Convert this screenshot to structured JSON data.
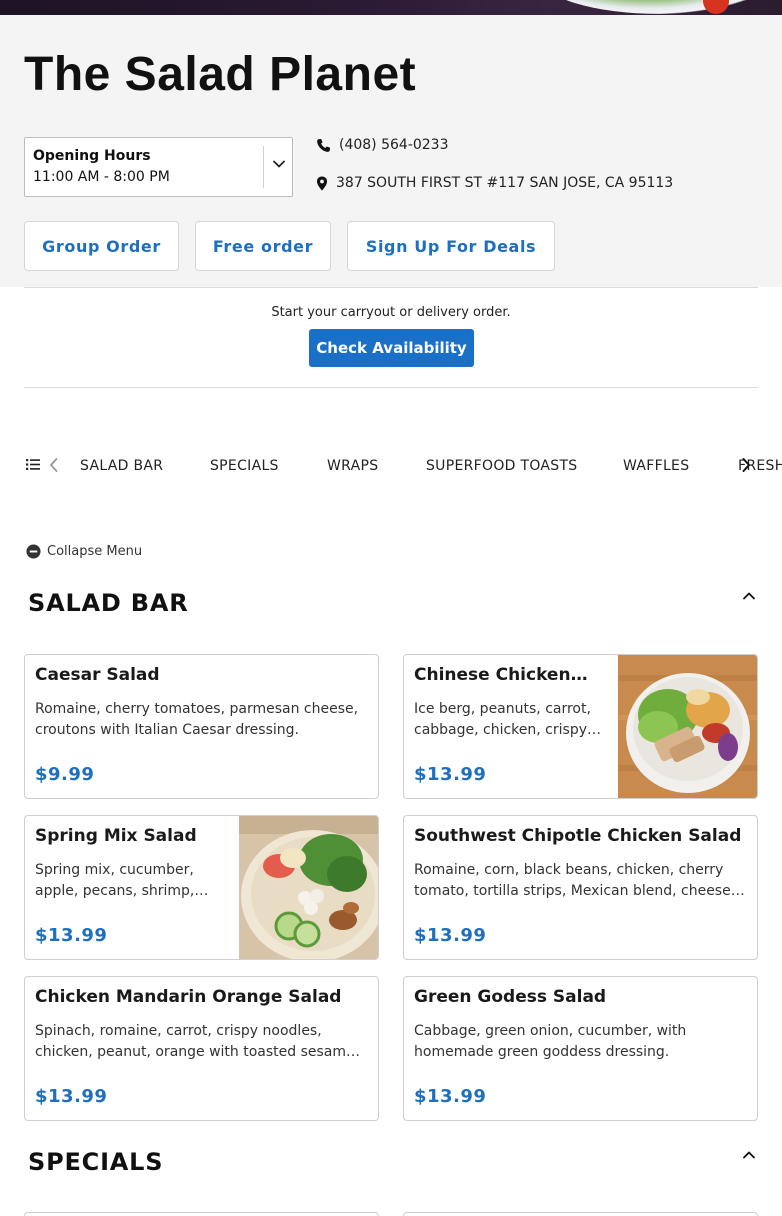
{
  "restaurant": {
    "name": "The Salad Planet",
    "hours_title": "Opening Hours",
    "hours_value": "11:00 AM - 8:00 PM",
    "phone": "(408) 564-0233",
    "address": "387 SOUTH FIRST ST #117 SAN JOSE, CA 95113"
  },
  "actions": {
    "group_order": "Group Order",
    "free_order": "Free order",
    "sign_up": "Sign Up For Deals"
  },
  "order": {
    "prompt": "Start your carryout or delivery order.",
    "check_button": "Check Availability"
  },
  "categories": [
    "SALAD BAR",
    "SPECIALS",
    "WRAPS",
    "SUPERFOOD TOASTS",
    "WAFFLES",
    "FRESH"
  ],
  "collapse_label": "Collapse Menu",
  "sections": [
    {
      "title": "SALAD BAR",
      "items": [
        {
          "name": "Caesar Salad",
          "desc": "Romaine, cherry tomatoes, parmesan cheese, croutons with Italian Caesar dressing.",
          "price": "$9.99"
        },
        {
          "name": "Chinese Chicken…",
          "desc": "Ice berg, peanuts, carrot, cabbage, chicken, crispy…",
          "price": "$13.99"
        },
        {
          "name": "Spring Mix Salad",
          "desc": "Spring mix, cucumber, apple, pecans, shrimp,…",
          "price": "$13.99"
        },
        {
          "name": "Southwest Chipotle Chicken Salad",
          "desc": "Romaine, corn, black beans, chicken, cherry tomato, tortilla strips, Mexican blend, cheese…",
          "price": "$13.99"
        },
        {
          "name": "Chicken Mandarin Orange Salad",
          "desc": "Spinach, romaine, carrot, crispy noodles, chicken, peanut, orange with toasted sesam…",
          "price": "$13.99"
        },
        {
          "name": "Green Godess Salad",
          "desc": "Cabbage, green onion, cucumber, with homemade green goddess dressing.",
          "price": "$13.99"
        }
      ]
    },
    {
      "title": "SPECIALS",
      "items": []
    }
  ],
  "colors": {
    "accent": "#1d6fbf",
    "button": "#1a6fc7",
    "header_bg": "#f4f4f5"
  },
  "icons": [
    "phone-icon",
    "location-pin-icon",
    "chevron-down-icon",
    "list-icon",
    "chevron-left-icon",
    "chevron-right-icon",
    "minus-circle-icon",
    "chevron-up-icon"
  ]
}
